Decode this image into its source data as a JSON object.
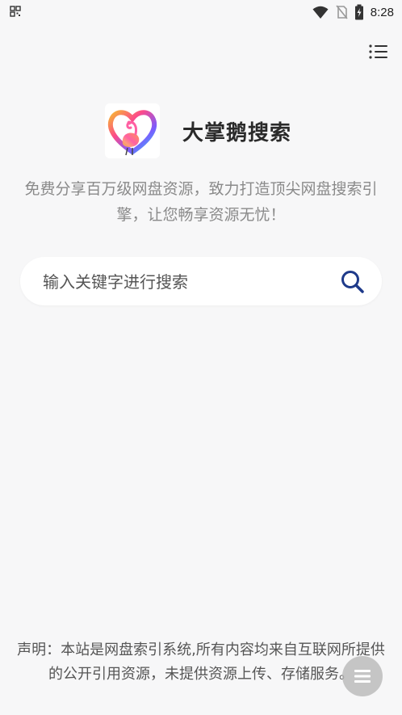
{
  "status_bar": {
    "time": "8:28",
    "icons": [
      "qr-grid-icon",
      "wifi-icon",
      "no-sim-icon",
      "battery-charging-icon"
    ]
  },
  "header": {
    "menu_icon": "list-menu-icon"
  },
  "brand": {
    "title": "大掌鹅搜索",
    "logo": "flamingo-heart-logo"
  },
  "tagline": "免费分享百万级网盘资源，致力打造顶尖网盘搜索引擎，让您畅享资源无忧！",
  "search": {
    "placeholder": "输入关键字进行搜索",
    "value": "",
    "button_icon": "search-icon",
    "accent_color": "#1e3a8a"
  },
  "footer": {
    "disclaimer": "声明：本站是网盘索引系统,所有内容均来自互联网所提供的公开引用资源，未提供资源上传、存储服务。"
  },
  "fab": {
    "icon": "menu-lines-icon"
  }
}
